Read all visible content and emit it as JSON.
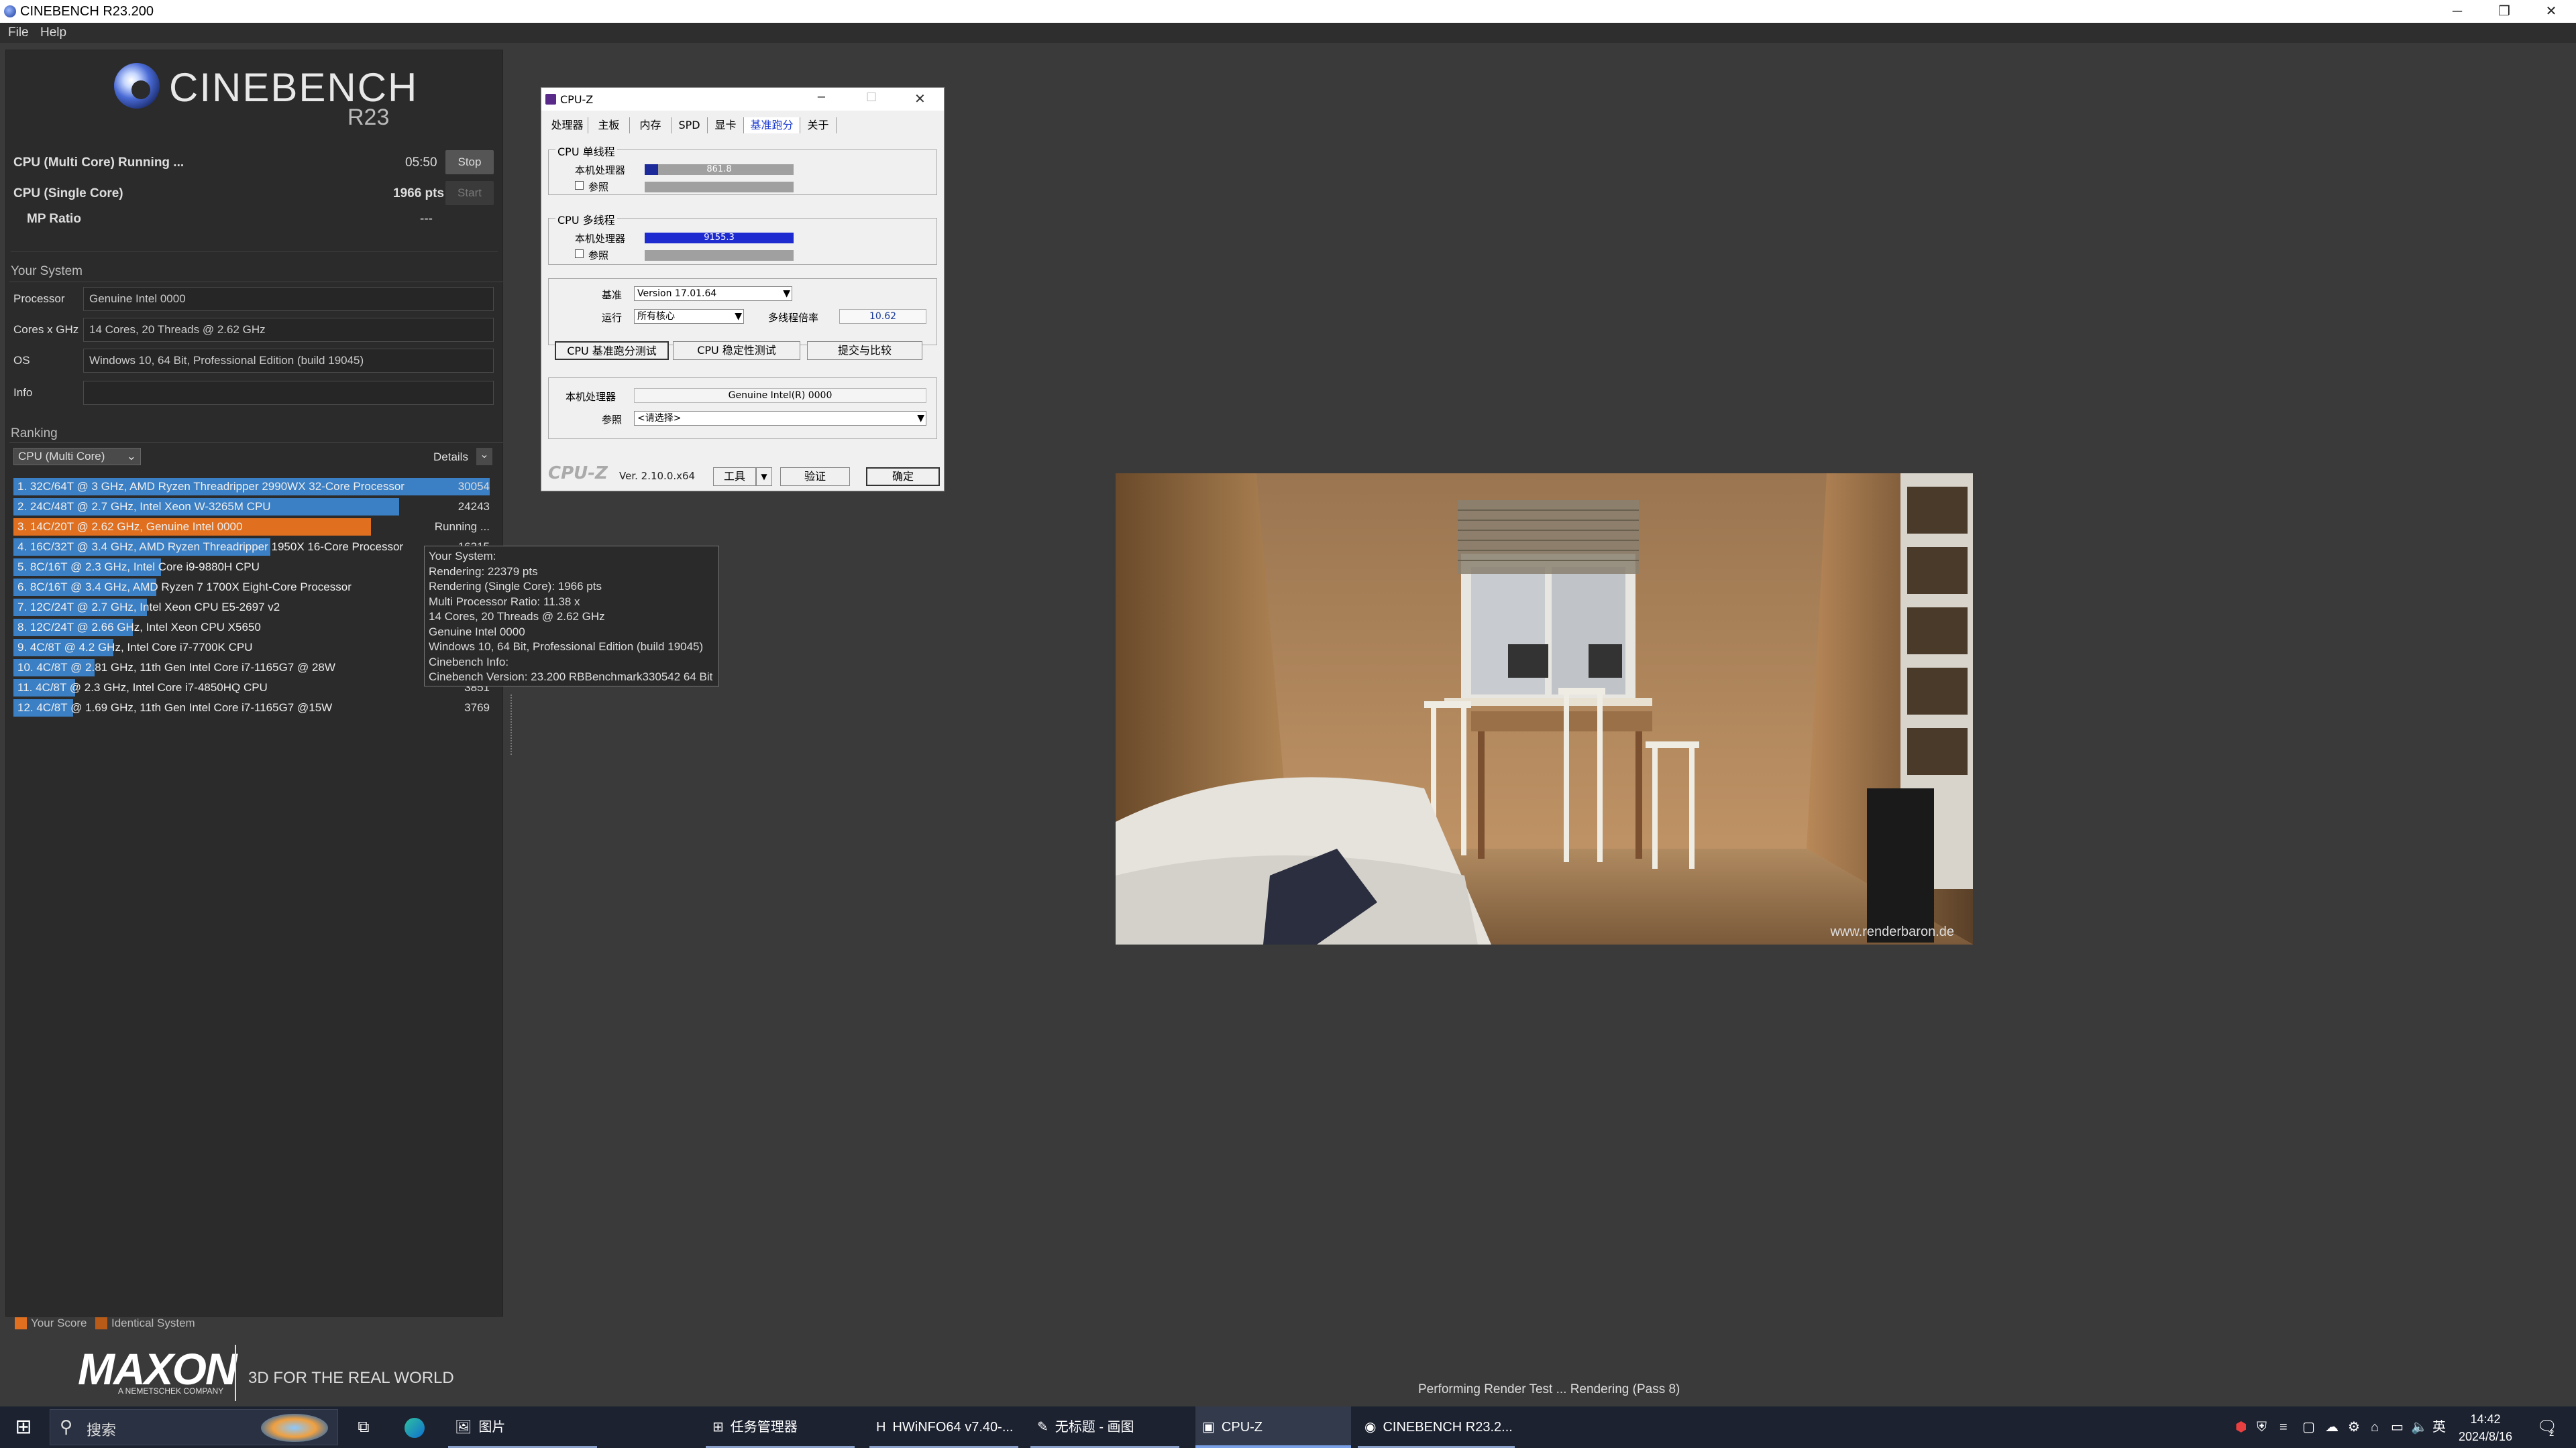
{
  "window": {
    "title": "CINEBENCH R23.200"
  },
  "menu": {
    "file": "File",
    "help": "Help"
  },
  "logo": {
    "name": "CINEBENCH",
    "version": "R23"
  },
  "tests": {
    "multi": {
      "label": "CPU (Multi Core)",
      "status": "Running ...",
      "time": "05:50",
      "button": "Stop"
    },
    "single": {
      "label": "CPU (Single Core)",
      "score": "1966 pts",
      "button": "Start"
    },
    "mp": {
      "label": "MP Ratio",
      "value": "---"
    }
  },
  "system": {
    "heading": "Your System",
    "rows": [
      {
        "label": "Processor",
        "value": "Genuine Intel 0000"
      },
      {
        "label": "Cores x GHz",
        "value": "14 Cores, 20 Threads @ 2.62 GHz"
      },
      {
        "label": "OS",
        "value": "Windows 10, 64 Bit, Professional Edition (build 19045)"
      },
      {
        "label": "Info",
        "value": ""
      }
    ]
  },
  "ranking": {
    "heading": "Ranking",
    "selector": "CPU (Multi Core)",
    "details": "Details",
    "items": [
      {
        "text": "1. 32C/64T @ 3 GHz, AMD Ryzen Threadripper 2990WX 32-Core Processor",
        "score": "30054",
        "fill": 1.0,
        "color": "#3b7fc4"
      },
      {
        "text": "2. 24C/48T @ 2.7 GHz, Intel Xeon W-3265M CPU",
        "score": "24243",
        "fill": 0.81,
        "color": "#3b7fc4"
      },
      {
        "text": "3. 14C/20T @ 2.62 GHz, Genuine Intel 0000",
        "score": "Running ...",
        "fill": 0.75,
        "color": "#e07020"
      },
      {
        "text": "4. 16C/32T @ 3.4 GHz, AMD Ryzen Threadripper 1950X 16-Core Processor",
        "score": "16315",
        "fill": 0.54,
        "color": "#3b7fc4"
      },
      {
        "text": "5. 8C/16T @ 2.3 GHz, Intel Core i9-9880H CPU",
        "score": "",
        "fill": 0.31,
        "color": "#3b7fc4"
      },
      {
        "text": "6. 8C/16T @ 3.4 GHz, AMD Ryzen 7 1700X Eight-Core Processor",
        "score": "",
        "fill": 0.3,
        "color": "#3b7fc4"
      },
      {
        "text": "7. 12C/24T @ 2.7 GHz, Intel Xeon CPU E5-2697 v2",
        "score": "",
        "fill": 0.28,
        "color": "#3b7fc4"
      },
      {
        "text": "8. 12C/24T @ 2.66 GHz, Intel Xeon CPU X5650",
        "score": "",
        "fill": 0.25,
        "color": "#3b7fc4"
      },
      {
        "text": "9. 4C/8T @ 4.2 GHz, Intel Core i7-7700K CPU",
        "score": "",
        "fill": 0.21,
        "color": "#3b7fc4"
      },
      {
        "text": "10. 4C/8T @ 2.81 GHz, 11th Gen Intel Core i7-1165G7 @ 28W",
        "score": "",
        "fill": 0.17,
        "color": "#3b7fc4"
      },
      {
        "text": "11. 4C/8T @ 2.3 GHz, Intel Core i7-4850HQ CPU",
        "score": "3851",
        "fill": 0.13,
        "color": "#3b7fc4"
      },
      {
        "text": "12. 4C/8T @ 1.69 GHz, 11th Gen Intel Core i7-1165G7 @15W",
        "score": "3769",
        "fill": 0.125,
        "color": "#3b7fc4"
      }
    ]
  },
  "tooltip": {
    "lines": [
      "Your System:",
      "Rendering: 22379 pts",
      "Rendering (Single Core): 1966 pts",
      "Multi Processor Ratio: 11.38 x",
      "14 Cores, 20 Threads @ 2.62 GHz",
      "Genuine Intel 0000",
      "Windows 10, 64 Bit, Professional Edition (build 19045)",
      "Cinebench Info:",
      "Cinebench Version: 23.200 RBBenchmark330542 64 Bit"
    ]
  },
  "legend": {
    "your_score": "Your Score",
    "identical": "Identical System"
  },
  "footer": {
    "brand": "MAXON",
    "sub": "A NEMETSCHEK COMPANY",
    "tagline": "3D FOR THE REAL WORLD",
    "status": "Performing Render Test ... Rendering (Pass 8)"
  },
  "render": {
    "watermark": "www.renderbaron.de"
  },
  "cpuz": {
    "title": "CPU-Z",
    "tabs": [
      "处理器",
      "主板",
      "内存",
      "SPD",
      "显卡",
      "基准跑分",
      "关于"
    ],
    "active_tab": 5,
    "single": {
      "group": "CPU 单线程",
      "this_label": "本机处理器",
      "this_value": "861.8",
      "this_fill": 0.09,
      "ref_label": "参照"
    },
    "multi": {
      "group": "CPU 多线程",
      "this_label": "本机处理器",
      "this_value": "9155.3",
      "this_fill": 1.0,
      "ref_label": "参照"
    },
    "bench_label": "基准",
    "bench_value": "Version 17.01.64",
    "run_label": "运行",
    "run_value": "所有核心",
    "ratio_label": "多线程倍率",
    "ratio_value": "10.62",
    "btn_bench": "CPU 基准跑分测试",
    "btn_stress": "CPU 稳定性测试",
    "btn_submit": "提交与比较",
    "this_cpu_label": "本机处理器",
    "this_cpu_value": "Genuine Intel(R) 0000",
    "ref_label": "参照",
    "ref_value": "<请选择>",
    "brand": "CPU-Z",
    "version": "Ver. 2.10.0.x64",
    "tools": "工具",
    "validate": "验证",
    "ok": "确定"
  },
  "taskbar": {
    "search": "搜索",
    "apps": [
      {
        "label": "图片",
        "active": false
      },
      {
        "label": "任务管理器",
        "active": false
      },
      {
        "label": "HWiNFO64 v7.40-...",
        "active": false
      },
      {
        "label": "无标题 - 画图",
        "active": false
      },
      {
        "label": "CPU-Z",
        "active": true
      },
      {
        "label": "CINEBENCH R23.2...",
        "active": false
      }
    ],
    "ime": "英",
    "time": "14:42",
    "date": "2024/8/16",
    "notification_count": "2"
  }
}
